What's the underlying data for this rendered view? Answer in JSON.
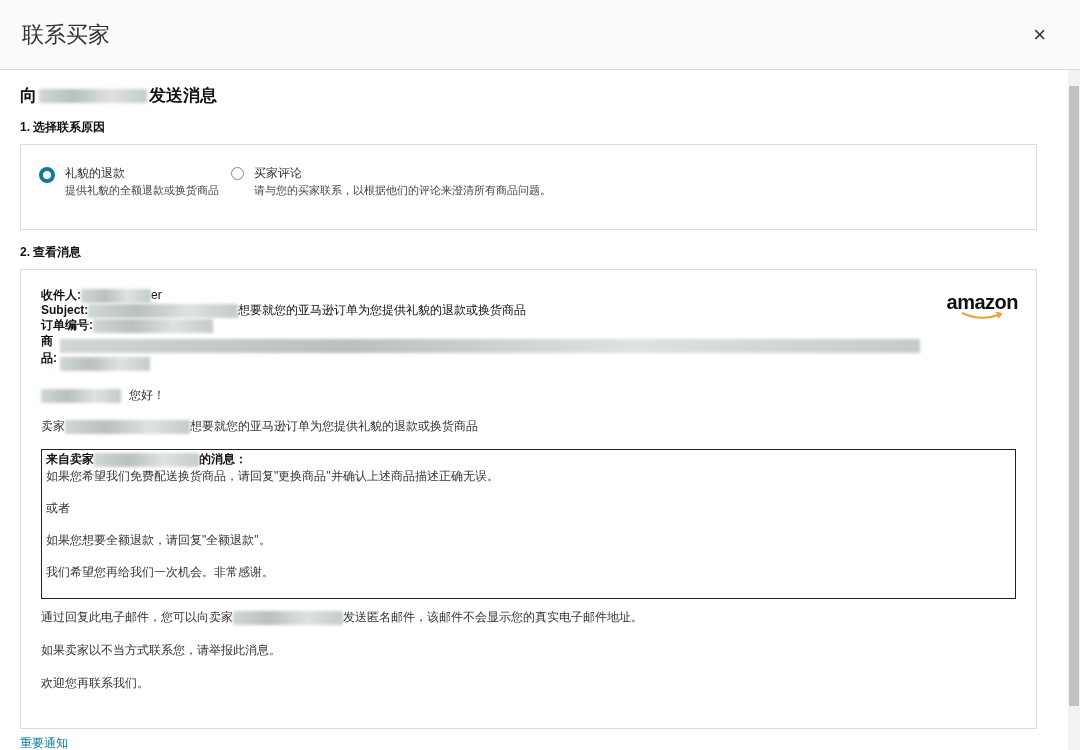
{
  "dialog": {
    "title": "联系买家",
    "close": "×"
  },
  "heading": {
    "prefix": "向",
    "suffix": "发送消息"
  },
  "step_1": "1. 选择联系原因",
  "reasons": [
    {
      "label": "礼貌的退款",
      "description": "提供礼貌的全额退款或换货商品",
      "selected": true
    },
    {
      "label": "买家评论",
      "description": "请与您的买家联系，以根据他们的评论来澄清所有商品问题。",
      "selected": false
    }
  ],
  "step_2": "2. 查看消息",
  "message": {
    "recipient_label": "收件人:",
    "recipient_tail": "er",
    "subject_label": "Subject:",
    "subject_tail": "想要就您的亚马逊订单为您提供礼貌的退款或换货商品",
    "order_label": "订单编号:",
    "product_label": "商品:",
    "logo": "amazon",
    "greeting": "您好！",
    "intro_prefix": "卖家",
    "intro_suffix": "想要就您的亚马逊订单为您提供礼貌的退款或换货商品",
    "seller_box": {
      "title_prefix": "来自卖家",
      "title_suffix": "的消息：",
      "lines": [
        "如果您希望我们免费配送换货商品，请回复\"更换商品\"并确认上述商品描述正确无误。",
        "或者",
        "如果您想要全额退款，请回复\"全额退款\"。",
        "我们希望您再给我们一次机会。非常感谢。"
      ]
    },
    "footer_prefix": "通过回复此电子邮件，您可以向卖家",
    "footer_suffix": "发送匿名邮件，该邮件不会显示您的真实电子邮件地址。",
    "report": "如果卖家以不当方式联系您，请举报此消息。",
    "closing": "欢迎您再联系我们。"
  },
  "notice_link": "重要通知"
}
